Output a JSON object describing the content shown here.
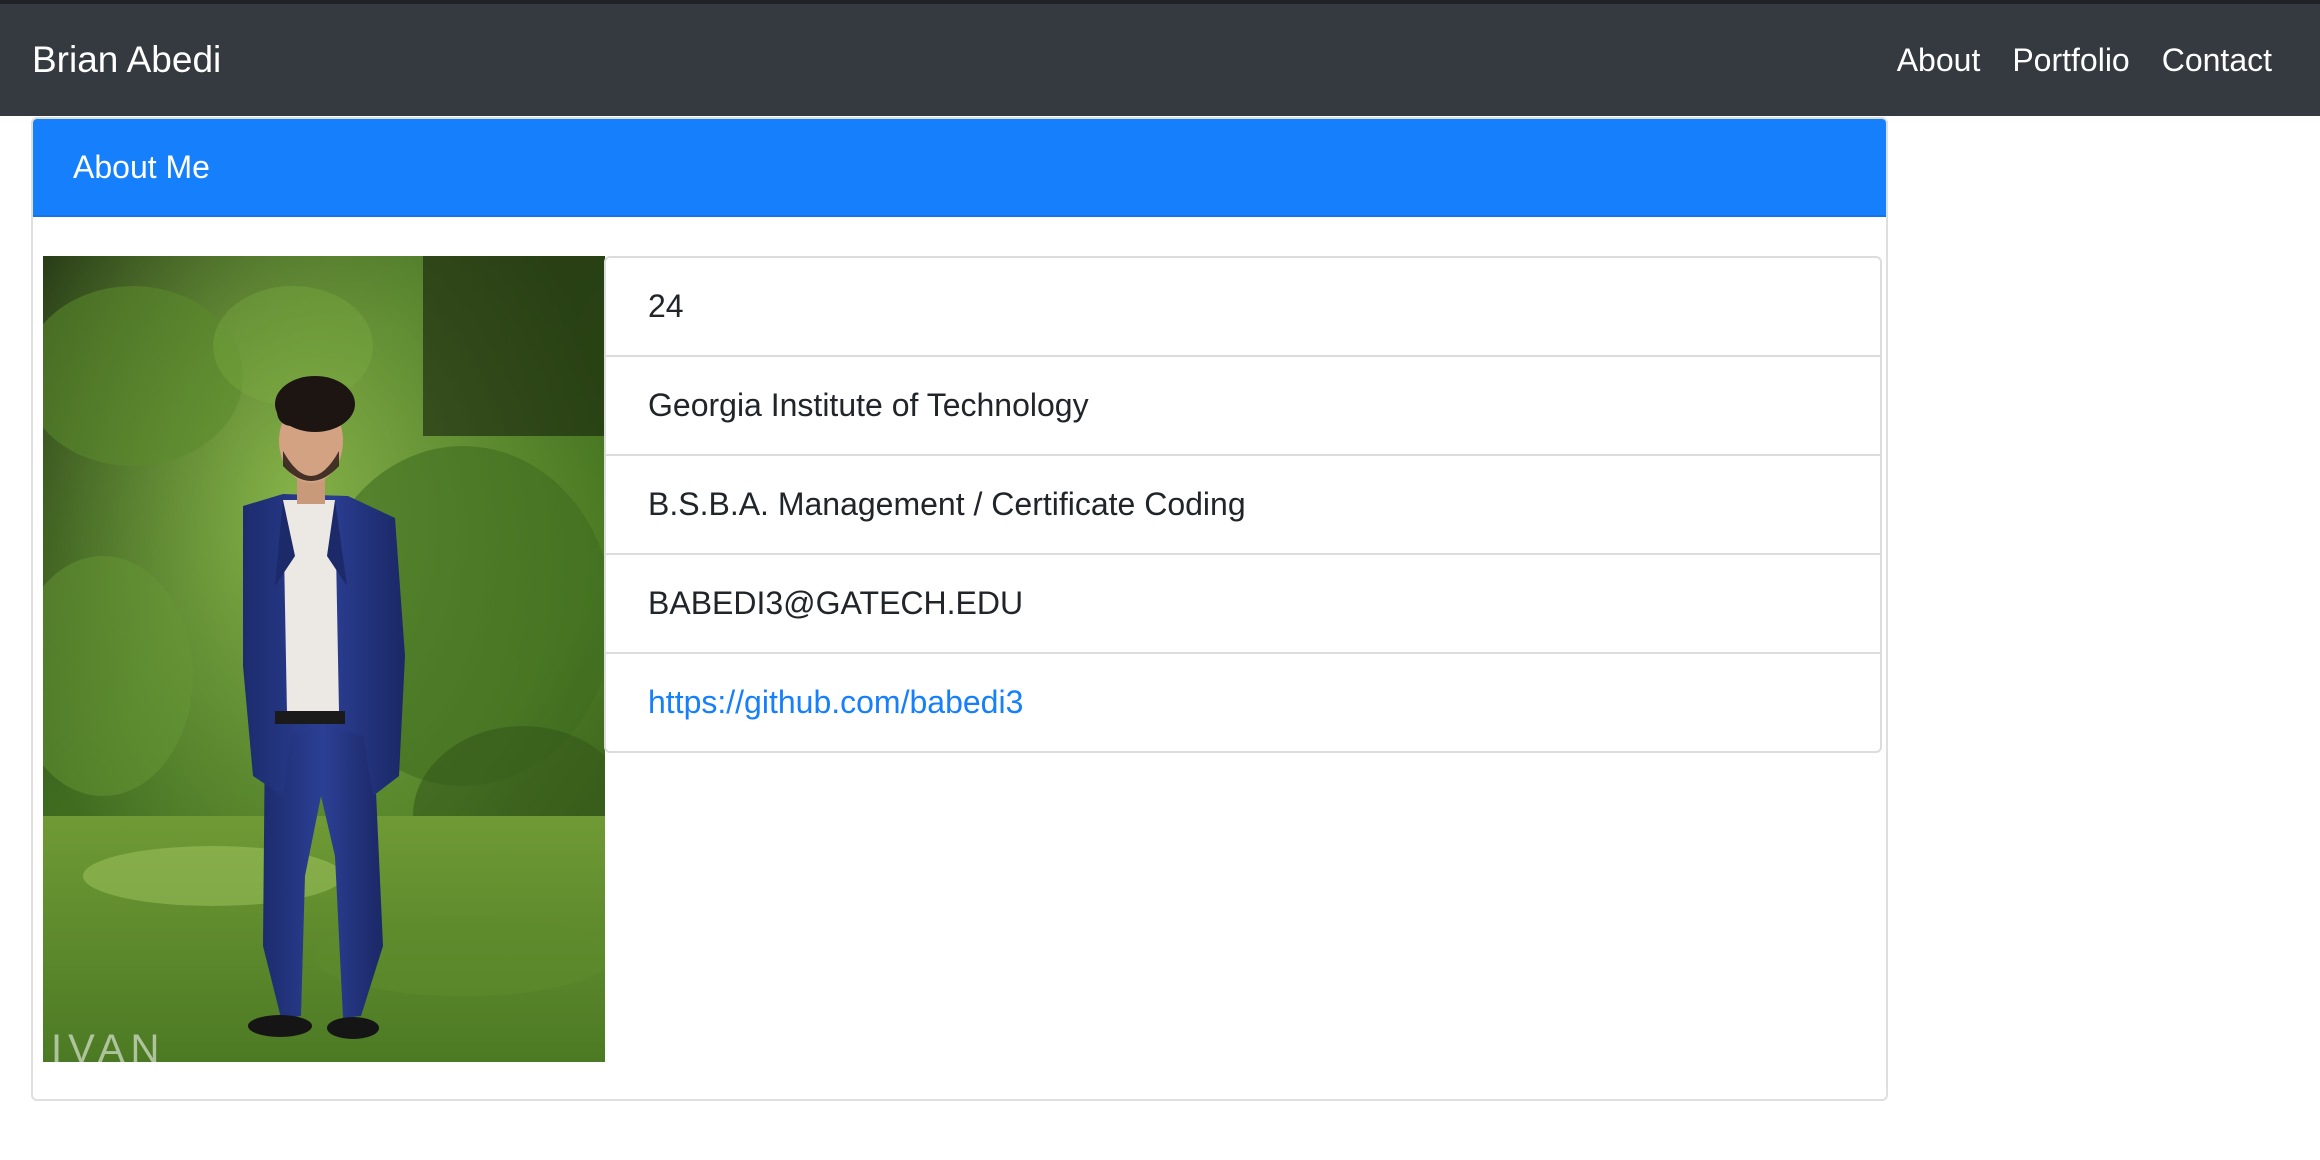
{
  "navbar": {
    "brand": "Brian Abedi",
    "links": [
      {
        "label": "About"
      },
      {
        "label": "Portfolio"
      },
      {
        "label": "Contact"
      }
    ]
  },
  "about_card": {
    "title": "About Me",
    "photo": {
      "watermark": "IVAN"
    },
    "details": {
      "age": "24",
      "school": "Georgia Institute of Technology",
      "degree": "B.S.B.A. Management / Certificate Coding",
      "email": "BABEDI3@GATECH.EDU",
      "github": "https://github.com/babedi3"
    }
  },
  "colors": {
    "navbar_bg": "#343a40",
    "header_bg": "#167ffc",
    "link": "#167ffc",
    "text": "#212529"
  }
}
